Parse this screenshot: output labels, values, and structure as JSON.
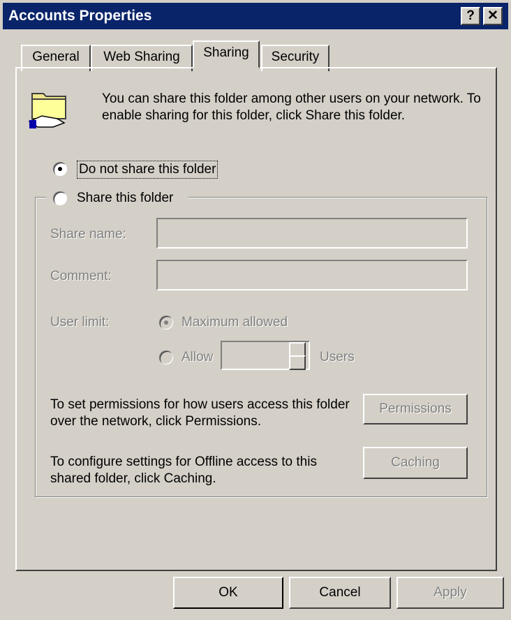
{
  "window": {
    "title": "Accounts Properties",
    "help_glyph": "?",
    "close_glyph": "✕"
  },
  "tabs": [
    {
      "label": "General"
    },
    {
      "label": "Web Sharing"
    },
    {
      "label": "Sharing",
      "active": true
    },
    {
      "label": "Security"
    }
  ],
  "info_text": "You can share this folder among other users on your network.  To enable sharing for this folder, click Share this folder.",
  "options": {
    "do_not_share": "Do not share this folder",
    "share": "Share this folder"
  },
  "fields": {
    "share_name_label": "Share name:",
    "share_name_value": "",
    "comment_label": "Comment:",
    "comment_value": "",
    "user_limit_label": "User limit:",
    "max_allowed": "Maximum allowed",
    "allow": "Allow",
    "allow_value": "",
    "users": "Users"
  },
  "permissions": {
    "text": "To set permissions for how users access this folder over the network, click Permissions.",
    "button": "Permissions"
  },
  "caching": {
    "text": "To configure settings for Offline access to this shared folder, click Caching.",
    "button": "Caching"
  },
  "buttons": {
    "ok": "OK",
    "cancel": "Cancel",
    "apply": "Apply"
  },
  "colors": {
    "titlebar": "#0a246a",
    "face": "#d4d0c8",
    "disabled_text": "#808080"
  },
  "icons": [
    "help-icon",
    "close-icon",
    "shared-folder-icon"
  ]
}
